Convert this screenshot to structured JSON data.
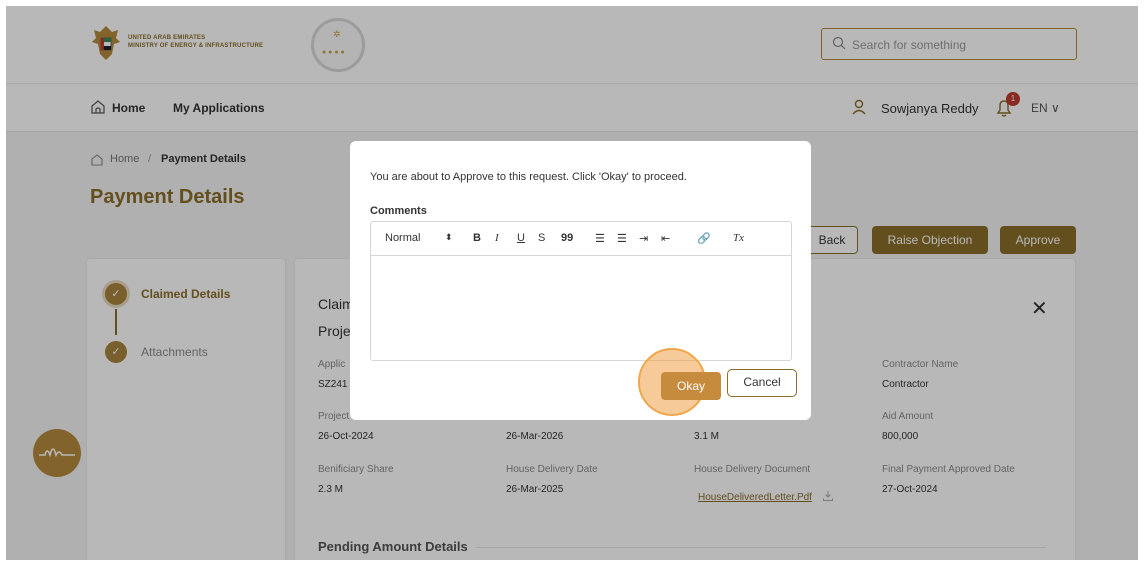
{
  "header": {
    "ministry_line1": "UNITED ARAB EMIRATES",
    "ministry_line2": "MINISTRY OF ENERGY & INFRASTRUCTURE",
    "search_placeholder": "Search for something"
  },
  "nav": {
    "home": "Home",
    "my_applications": "My Applications",
    "user_name": "Sowjanya Reddy",
    "notification_count": "1",
    "language": "EN ∨"
  },
  "breadcrumb": {
    "home": "Home",
    "separator": "/",
    "current": "Payment Details"
  },
  "page": {
    "title": "Payment Details",
    "back_label": "Back",
    "raise_objection_label": "Raise Objection",
    "approve_label": "Approve"
  },
  "steps": [
    {
      "label": "Claimed Details"
    },
    {
      "label": "Attachments"
    }
  ],
  "details": {
    "section_claim": "Claim",
    "section_project": "Proje",
    "applic_label": "Applic",
    "applic_value": "SZ241",
    "project_label": "Project",
    "project_value": "26-Oct-2024",
    "col2_row2_value": "26-Mar-2026",
    "col3_row2_value": "3.1 M",
    "contractor_label": "Contractor Name",
    "contractor_value": "Contractor",
    "aid_label": "Aid Amount",
    "aid_value": "800,000",
    "beneficiary_label": "Benificiary Share",
    "beneficiary_value": "2.3 M",
    "house_delivery_label": "House Delivery Date",
    "house_delivery_value": "26-Mar-2025",
    "house_doc_label": "House Delivery Document",
    "house_doc_value": "HouseDeliveredLetter.Pdf",
    "final_payment_label": "Final Payment Approved Date",
    "final_payment_value": "27-Oct-2024",
    "pending_section": "Pending Amount Details"
  },
  "modal": {
    "message": "You are about to Approve to this request. Click 'Okay' to proceed.",
    "comments_label": "Comments",
    "toolbar": {
      "format": "Normal",
      "format_arrow": "⬍",
      "bold": "B",
      "italic": "I",
      "underline": "U",
      "strike": "S",
      "quote": "99",
      "ordered_list": "☰",
      "bullet_list": "☰",
      "indent": "⇥",
      "outdent": "⇤",
      "link": "🔗",
      "clear": "Tx"
    },
    "okay_label": "Okay",
    "cancel_label": "Cancel"
  },
  "colors": {
    "brand": "#8a6d2a",
    "accent": "#c78b3e",
    "overlay": "rgba(0,0,0,0.28)"
  }
}
